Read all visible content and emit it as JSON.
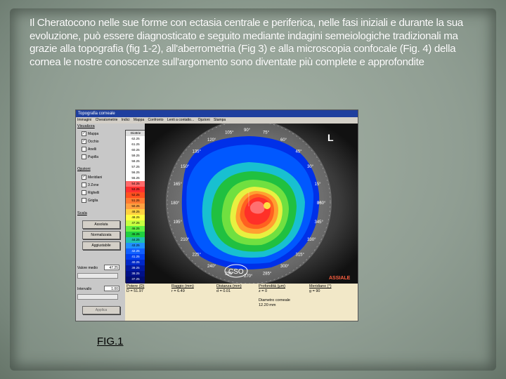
{
  "slide": {
    "intro_text": "Il Cheratocono nelle sue forme con ectasia centrale e periferica, nelle fasi iniziali e durante la sua evoluzione, può essere diagnosticato e seguito mediante indagini semeiologiche tradizionali ma grazie alla topografia (fig 1-2), all'aberrometria (Fig 3) e alla microscopia confocale (Fig. 4) della cornea le nostre conoscenze sull'argomento sono diventate più complete e approfondite",
    "caption": "FIG.1"
  },
  "app": {
    "title": "Topografia corneale",
    "menu": [
      "Immagini",
      "Cheratometrie",
      "Indici",
      "Mappa",
      "Confronto",
      "Lenti a contatto...",
      "Opzioni",
      "Stampa"
    ],
    "visualizza": {
      "label": "Visualizza",
      "items": [
        {
          "label": "Mappa",
          "checked": true
        },
        {
          "label": "Occhio",
          "checked": true
        },
        {
          "label": "Anelli",
          "checked": false
        },
        {
          "label": "Pupilla",
          "checked": false
        }
      ]
    },
    "opzioni": {
      "label": "Opzioni",
      "items": [
        {
          "label": "Meridiani",
          "checked": true
        },
        {
          "label": "3 Zone",
          "checked": false
        },
        {
          "label": "Righelli",
          "checked": false
        },
        {
          "label": "Griglia",
          "checked": false
        }
      ]
    },
    "scala": {
      "label": "Scala",
      "buttons": [
        "Assoluta",
        "Normalizzata",
        "Aggiustabile"
      ]
    },
    "valore_medio": {
      "label": "Valore medio",
      "value": "47.25"
    },
    "intervallo": {
      "label": "Intervallo",
      "value": "1.00"
    },
    "applica_label": "Applica",
    "scale_header": "Diottrie",
    "scale_values": [
      "62.25",
      "61.25",
      "60.25",
      "59.25",
      "58.25",
      "57.25",
      "56.25",
      "55.25",
      "54.25",
      "53.25",
      "52.25",
      "51.25",
      "50.25",
      "49.25",
      "48.25",
      "47.25",
      "46.25",
      "45.25",
      "44.25",
      "43.25",
      "42.25",
      "41.25",
      "40.25",
      "39.25",
      "38.25",
      "37.25",
      "32.25"
    ],
    "scale_colors": [
      "#ffffff",
      "#ffffff",
      "#ffffff",
      "#ffffff",
      "#ffffff",
      "#ffffff",
      "#ffffff",
      "#ffffff",
      "#ff6a6a",
      "#ff3030",
      "#ff5020",
      "#ff7a30",
      "#ffa040",
      "#ffd040",
      "#ffff40",
      "#c8ff40",
      "#60f040",
      "#20d040",
      "#20c0b0",
      "#2090ff",
      "#1060ff",
      "#0040f0",
      "#0028c8",
      "#0018a0",
      "#001088",
      "#000c70",
      "#000a58"
    ],
    "map": {
      "eye_label": "L",
      "logo": "CSO",
      "mode": "ASSIALE",
      "meridians": [
        "90°",
        "75°",
        "60°",
        "45°",
        "30°",
        "15°",
        "0°",
        "360°",
        "345°",
        "330°",
        "315°",
        "300°",
        "285°",
        "270°",
        "255°",
        "240°",
        "225°",
        "210°",
        "195°",
        "180°",
        "165°",
        "150°",
        "135°",
        "120°",
        "105°"
      ]
    },
    "readouts": [
      {
        "label": "Potere (D)",
        "value": "D = 51.97"
      },
      {
        "label": "Raggio (mm)",
        "value": "r = 6.49"
      },
      {
        "label": "Distanza (mm)",
        "value": "d = 0.01"
      },
      {
        "label": "Profondità (µm)",
        "value": "z = 0"
      },
      {
        "label": "Meridiano (°)",
        "value": "g = 90"
      }
    ],
    "diametro": {
      "label": "Diametro corneale",
      "value": "12.20 mm"
    }
  }
}
